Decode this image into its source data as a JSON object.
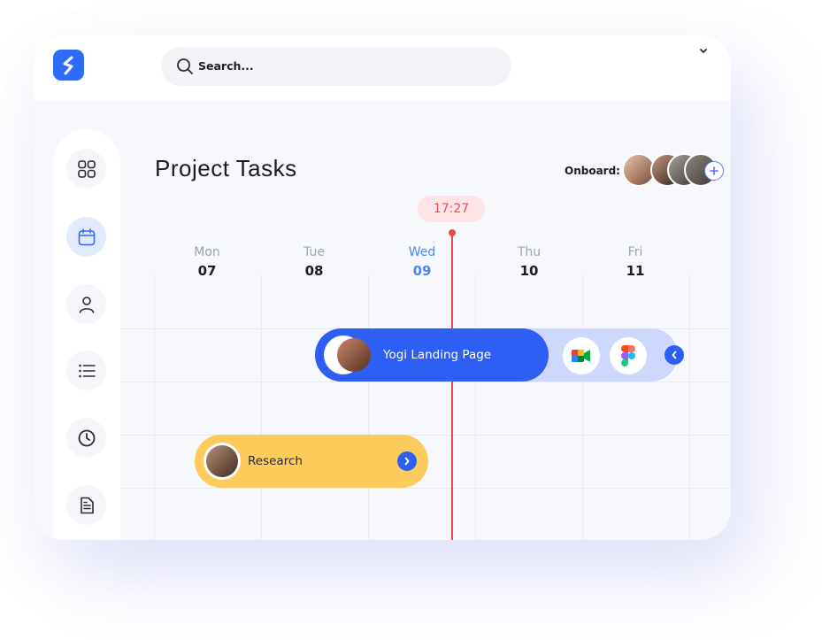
{
  "app": {
    "logo_icon": "s-logo-icon",
    "brand_color": "#2e6bfb"
  },
  "search": {
    "placeholder": "Search...",
    "icon": "search-icon"
  },
  "account_menu": {
    "icon": "chevron-down-icon"
  },
  "sidebar": {
    "items": [
      {
        "icon": "grid-icon",
        "active": false
      },
      {
        "icon": "calendar-icon",
        "active": true
      },
      {
        "icon": "user-icon",
        "active": false
      },
      {
        "icon": "list-icon",
        "active": false
      },
      {
        "icon": "clock-icon",
        "active": false
      },
      {
        "icon": "document-icon",
        "active": false
      }
    ]
  },
  "page": {
    "title": "Project Tasks"
  },
  "onboard": {
    "label": "Onboard:",
    "avatar_count": 4,
    "add_icon": "plus-icon"
  },
  "timeline": {
    "current_time": "17:27",
    "days": [
      {
        "name": "Mon",
        "date": "07",
        "current": false
      },
      {
        "name": "Tue",
        "date": "08",
        "current": false
      },
      {
        "name": "Wed",
        "date": "09",
        "current": true
      },
      {
        "name": "Thu",
        "date": "10",
        "current": false
      },
      {
        "name": "Fri",
        "date": "11",
        "current": false
      }
    ]
  },
  "tasks": [
    {
      "label": "Yogi Landing Page",
      "color": "#2d5ff4",
      "tools": [
        "google-meet-icon",
        "figma-icon"
      ],
      "action_icon": "chevron-left-icon"
    },
    {
      "label": "Research",
      "color": "#fdcb5b",
      "action_icon": "chevron-right-icon"
    }
  ]
}
